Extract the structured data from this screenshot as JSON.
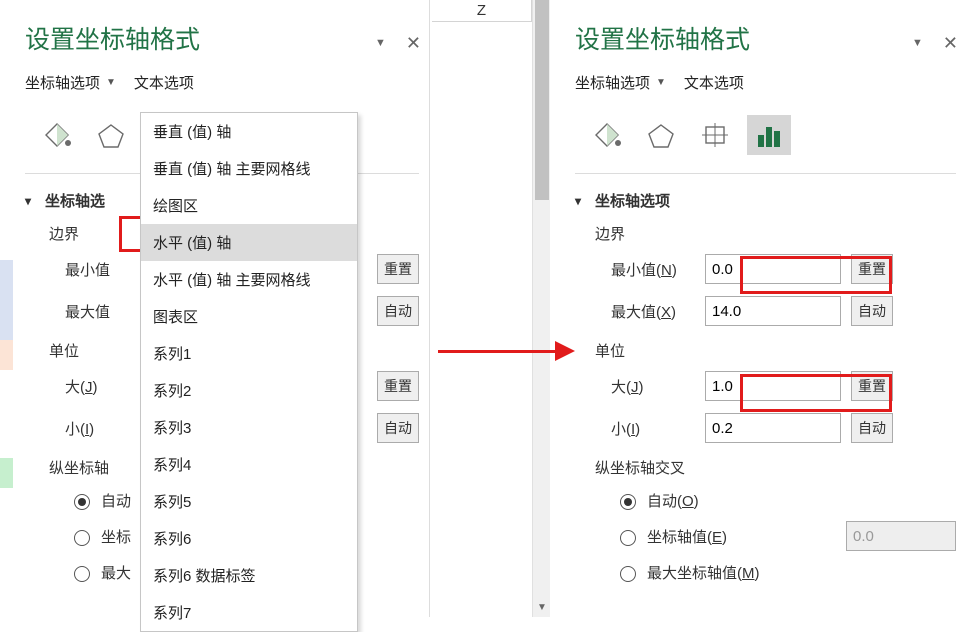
{
  "colors": {
    "accent": "#217346",
    "highlight": "#e11b1b"
  },
  "spreadsheet": {
    "column_letter": "Z"
  },
  "left": {
    "title": "设置坐标轴格式",
    "tabs": {
      "axis_options": "坐标轴选项",
      "text_options": "文本选项"
    },
    "icons": {
      "i1": "fill-icon",
      "i2": "effects-icon",
      "i3": "size-icon",
      "i4": "chart-icon"
    },
    "section": {
      "header": "坐标轴选",
      "bounds": {
        "label": "边界",
        "min_label": "最小值",
        "max_label": "最大值",
        "reset": "重置",
        "auto": "自动"
      },
      "units": {
        "label": "单位",
        "major_label": "大(J)",
        "minor_label": "小(I)",
        "reset": "重置",
        "auto": "自动"
      },
      "cross": {
        "label": "纵坐标轴",
        "opt_auto": "自动",
        "opt_value": "坐标",
        "opt_max": "最大"
      }
    },
    "dropdown": {
      "items": [
        "垂直 (值) 轴",
        "垂直 (值) 轴 主要网格线",
        "绘图区",
        "水平 (值) 轴",
        "水平 (值) 轴 主要网格线",
        "图表区",
        "系列1",
        "系列2",
        "系列3",
        "系列4",
        "系列5",
        "系列6",
        "系列6 数据标签",
        "系列7"
      ],
      "highlighted_index": 3
    }
  },
  "right": {
    "title": "设置坐标轴格式",
    "tabs": {
      "axis_options": "坐标轴选项",
      "text_options": "文本选项"
    },
    "icons": {
      "i1": "fill-icon",
      "i2": "effects-icon",
      "i3": "size-icon",
      "i4": "chart-icon",
      "active_index": 3
    },
    "section": {
      "header": "坐标轴选项",
      "bounds": {
        "label": "边界",
        "min_label": "最小值(N)",
        "min_value": "0.0",
        "min_btn": "重置",
        "max_label": "最大值(X)",
        "max_value": "14.0",
        "max_btn": "自动"
      },
      "units": {
        "label": "单位",
        "major_label": "大(J)",
        "major_value": "1.0",
        "major_btn": "重置",
        "minor_label": "小(I)",
        "minor_value": "0.2",
        "minor_btn": "自动"
      },
      "cross": {
        "label": "纵坐标轴交叉",
        "opt_auto": "自动(O)",
        "opt_value": "坐标轴值(E)",
        "value_input": "0.0",
        "opt_max": "最大坐标轴值(M)"
      }
    }
  }
}
